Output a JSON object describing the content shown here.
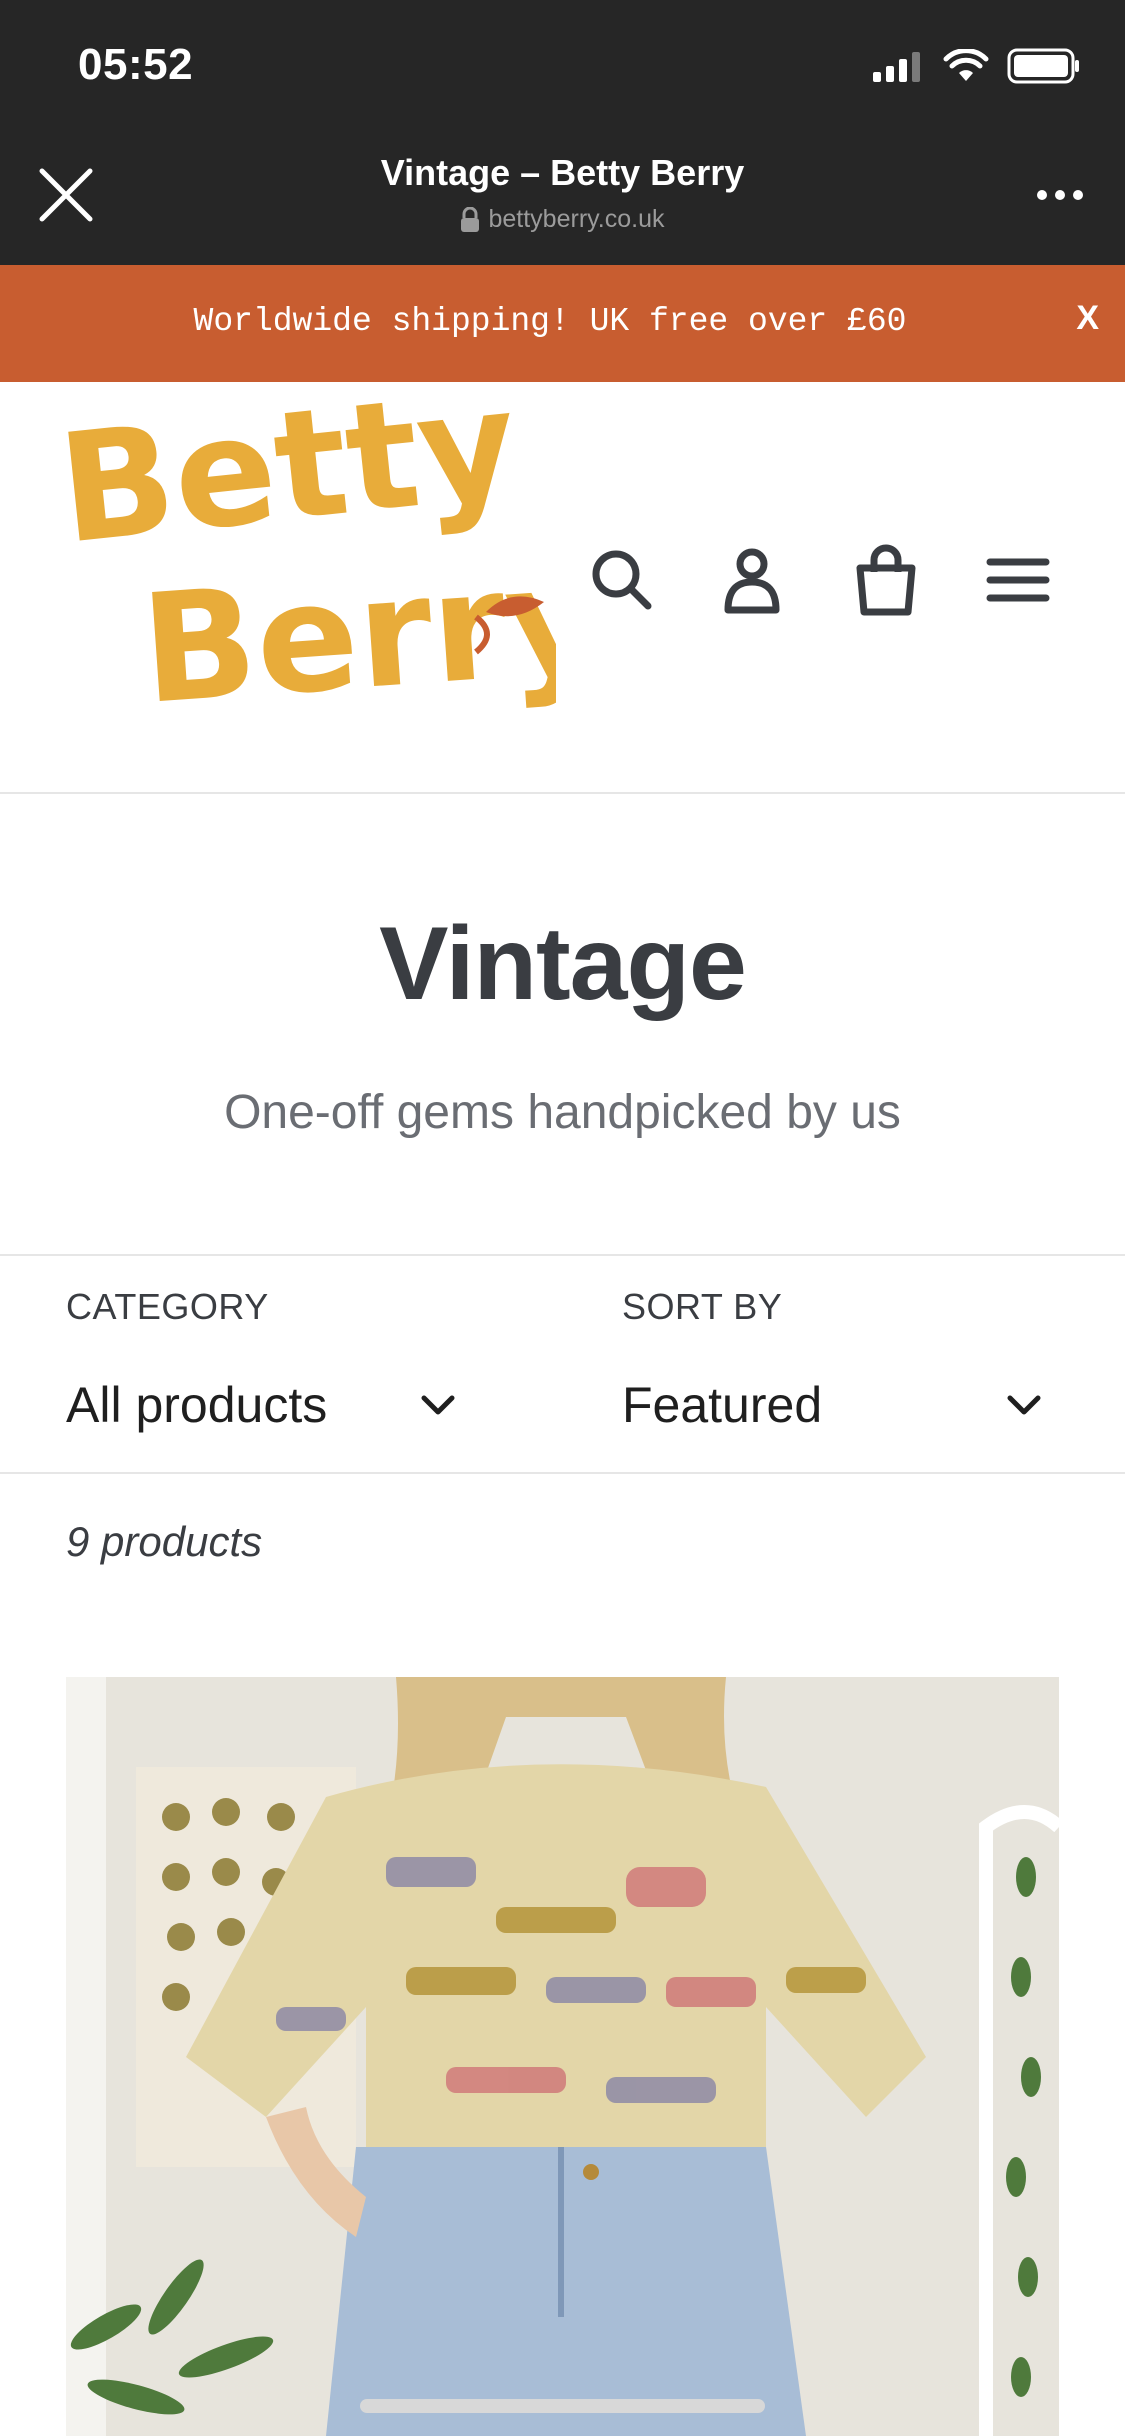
{
  "status_bar": {
    "time": "05:52"
  },
  "browser": {
    "title": "Vintage – Betty Berry",
    "url": "bettyberry.co.uk"
  },
  "announcement": {
    "text": "Worldwide shipping! UK free over £60",
    "close_label": "X"
  },
  "header": {
    "logo_text": "Betty Berry",
    "icons": [
      "search-icon",
      "account-icon",
      "cart-icon",
      "menu-icon"
    ]
  },
  "collection": {
    "title": "Vintage",
    "subtitle": "One-off gems handpicked by us"
  },
  "filters": {
    "category_label": "CATEGORY",
    "category_value": "All products",
    "sort_label": "SORT BY",
    "sort_value": "Featured"
  },
  "product_count": "9 products",
  "colors": {
    "chrome": "#262626",
    "announcement": "#c85d30",
    "logo": "#e8ac3a",
    "text": "#3a3d42"
  }
}
